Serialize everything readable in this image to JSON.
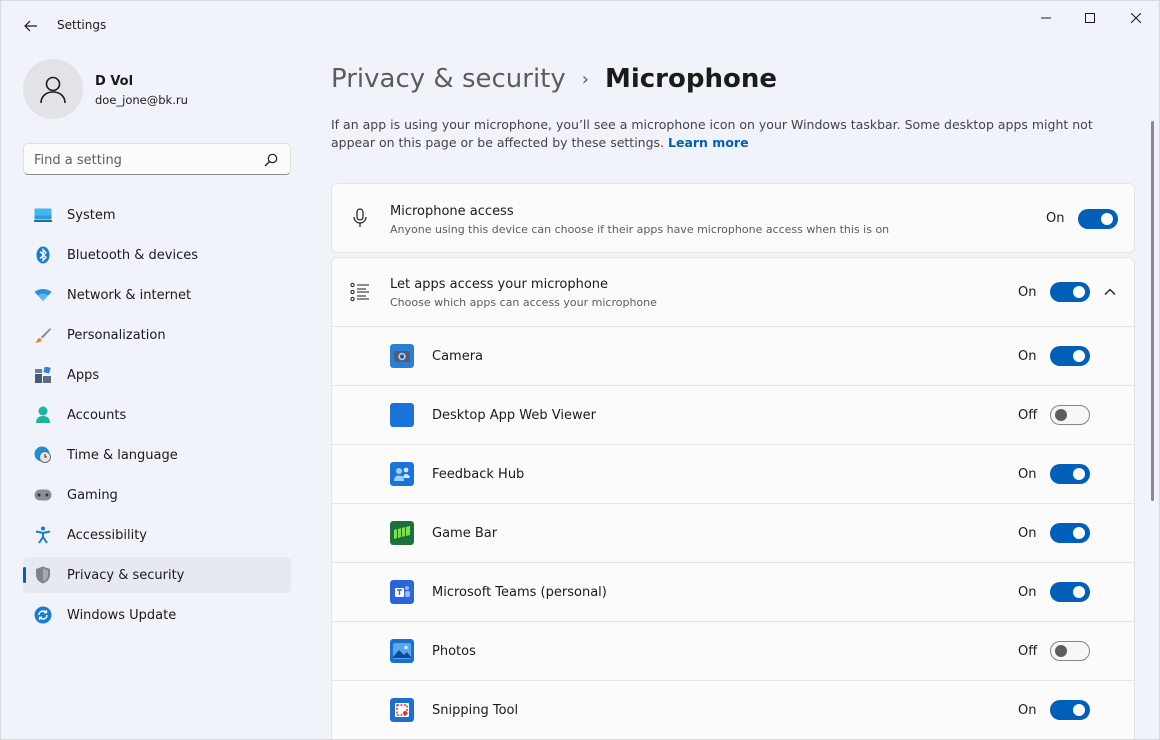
{
  "window": {
    "title": "Settings"
  },
  "profile": {
    "name": "D Vol",
    "email": "doe_jone@bk.ru"
  },
  "search": {
    "placeholder": "Find a setting"
  },
  "nav": {
    "items": [
      {
        "label": "System",
        "icon": "monitor-icon"
      },
      {
        "label": "Bluetooth & devices",
        "icon": "bluetooth-icon"
      },
      {
        "label": "Network & internet",
        "icon": "wifi-icon"
      },
      {
        "label": "Personalization",
        "icon": "brush-icon"
      },
      {
        "label": "Apps",
        "icon": "apps-icon"
      },
      {
        "label": "Accounts",
        "icon": "person-icon"
      },
      {
        "label": "Time & language",
        "icon": "clock-globe-icon"
      },
      {
        "label": "Gaming",
        "icon": "gamepad-icon"
      },
      {
        "label": "Accessibility",
        "icon": "accessibility-icon"
      },
      {
        "label": "Privacy & security",
        "icon": "shield-icon",
        "active": true
      },
      {
        "label": "Windows Update",
        "icon": "update-icon"
      }
    ]
  },
  "breadcrumb": {
    "parent": "Privacy & security",
    "separator": "›",
    "current": "Microphone"
  },
  "description": {
    "text": "If an app is using your microphone, you’ll see a microphone icon on your Windows taskbar. Some desktop apps might not appear on this page or be affected by these settings.",
    "link": "Learn more"
  },
  "microphone_access": {
    "title": "Microphone access",
    "subtitle": "Anyone using this device can choose if their apps have microphone access when this is on",
    "state": "On"
  },
  "apps_access": {
    "title": "Let apps access your microphone",
    "subtitle": "Choose which apps can access your microphone",
    "state": "On",
    "apps": [
      {
        "name": "Camera",
        "state": "On",
        "icon": "camera-app-icon"
      },
      {
        "name": "Desktop App Web Viewer",
        "state": "Off",
        "icon": "web-viewer-app-icon"
      },
      {
        "name": "Feedback Hub",
        "state": "On",
        "icon": "feedback-hub-app-icon"
      },
      {
        "name": "Game Bar",
        "state": "On",
        "icon": "game-bar-app-icon"
      },
      {
        "name": "Microsoft Teams (personal)",
        "state": "On",
        "icon": "teams-app-icon"
      },
      {
        "name": "Photos",
        "state": "Off",
        "icon": "photos-app-icon"
      },
      {
        "name": "Snipping Tool",
        "state": "On",
        "icon": "snipping-tool-app-icon"
      }
    ]
  },
  "colors": {
    "accent": "#005fb8",
    "background": "#f0f3f9",
    "card": "#fbfbfb"
  }
}
